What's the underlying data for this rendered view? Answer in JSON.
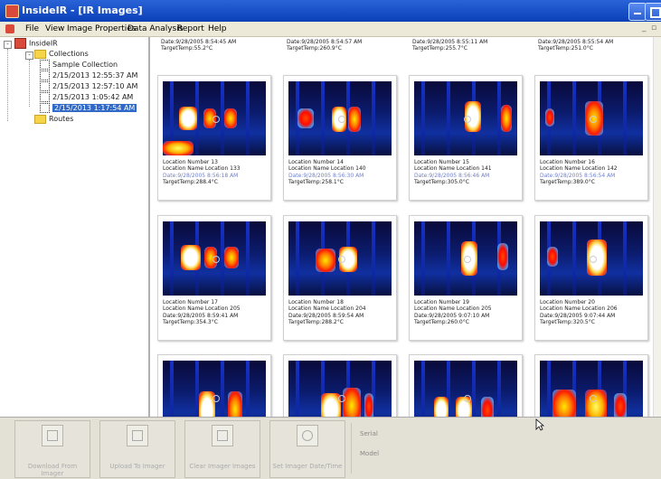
{
  "window": {
    "title": "InsideIR - [IR Images]"
  },
  "menu": [
    "File",
    "View",
    "Image Properties",
    "Data Analysis",
    "Report",
    "Help"
  ],
  "tree": {
    "root": "InsideIR",
    "collections": "Collections",
    "items": [
      "Sample Collection",
      "2/15/2013 12:55:37 AM",
      "2/15/2013 12:57:10 AM",
      "2/15/2013 1:05:42 AM",
      "2/15/2013 1:17:54 AM"
    ],
    "routes": "Routes"
  },
  "top_captions": [
    {
      "date": "Date:9/28/2005 8:54:45 AM",
      "temp": "TargetTemp:55.2°C"
    },
    {
      "date": "Date:9/28/2005 8:54:57 AM",
      "temp": "TargetTemp:260.9°C"
    },
    {
      "date": "Date:9/28/2005 8:55:11 AM",
      "temp": "TargetTemp:255.7°C"
    },
    {
      "date": "Date:9/28/2005 8:55:54 AM",
      "temp": "TargetTemp:251.0°C"
    }
  ],
  "cards": [
    {
      "l1": "Location Number 13",
      "l2": "Location Name Location 133",
      "l3": "Date:9/28/2005 8:56:18 AM",
      "l4": "TargetTemp:288.4°C"
    },
    {
      "l1": "Location Number 14",
      "l2": "Location Name Location 140",
      "l3": "Date:9/28/2005 8:56:30 AM",
      "l4": "TargetTemp:258.1°C"
    },
    {
      "l1": "Location Number 15",
      "l2": "Location Name Location 141",
      "l3": "Date:9/28/2005 8:56:46 AM",
      "l4": "TargetTemp:305.0°C"
    },
    {
      "l1": "Location Number 16",
      "l2": "Location Name Location 142",
      "l3": "Date:9/28/2005 8:56:54 AM",
      "l4": "TargetTemp:389.0°C"
    },
    {
      "l1": "Location Number 17",
      "l2": "Location Name Location 205",
      "l3": "Date:9/28/2005 8:59:41 AM",
      "l4": "TargetTemp:354.3°C"
    },
    {
      "l1": "Location Number 18",
      "l2": "Location Name Location 204",
      "l3": "Date:9/28/2005 8:59:54 AM",
      "l4": "TargetTemp:288.2°C"
    },
    {
      "l1": "Location Number 19",
      "l2": "Location Name Location 205",
      "l3": "Date:9/28/2005 9:07:10 AM",
      "l4": "TargetTemp:260.0°C"
    },
    {
      "l1": "Location Number 20",
      "l2": "Location Name Location 206",
      "l3": "Date:9/28/2005 9:07:44 AM",
      "l4": "TargetTemp:320.5°C"
    },
    {
      "l1": "",
      "l2": "",
      "l3": "",
      "l4": ""
    },
    {
      "l1": "",
      "l2": "",
      "l3": "",
      "l4": ""
    },
    {
      "l1": "",
      "l2": "",
      "l3": "",
      "l4": ""
    },
    {
      "l1": "",
      "l2": "",
      "l3": "",
      "l4": ""
    }
  ],
  "toolbar": {
    "download": "Download From Imager",
    "upload": "Upload To Imager",
    "clear": "Clear Imager Images",
    "set_time": "Set Imager Date/Time",
    "serial_label": "Serial",
    "model_label": "Model"
  },
  "colors": {
    "titlebar": "#0a3fb8",
    "selection": "#3169c6",
    "ir_hot": "#ff2a00",
    "ir_cold": "#000033"
  }
}
